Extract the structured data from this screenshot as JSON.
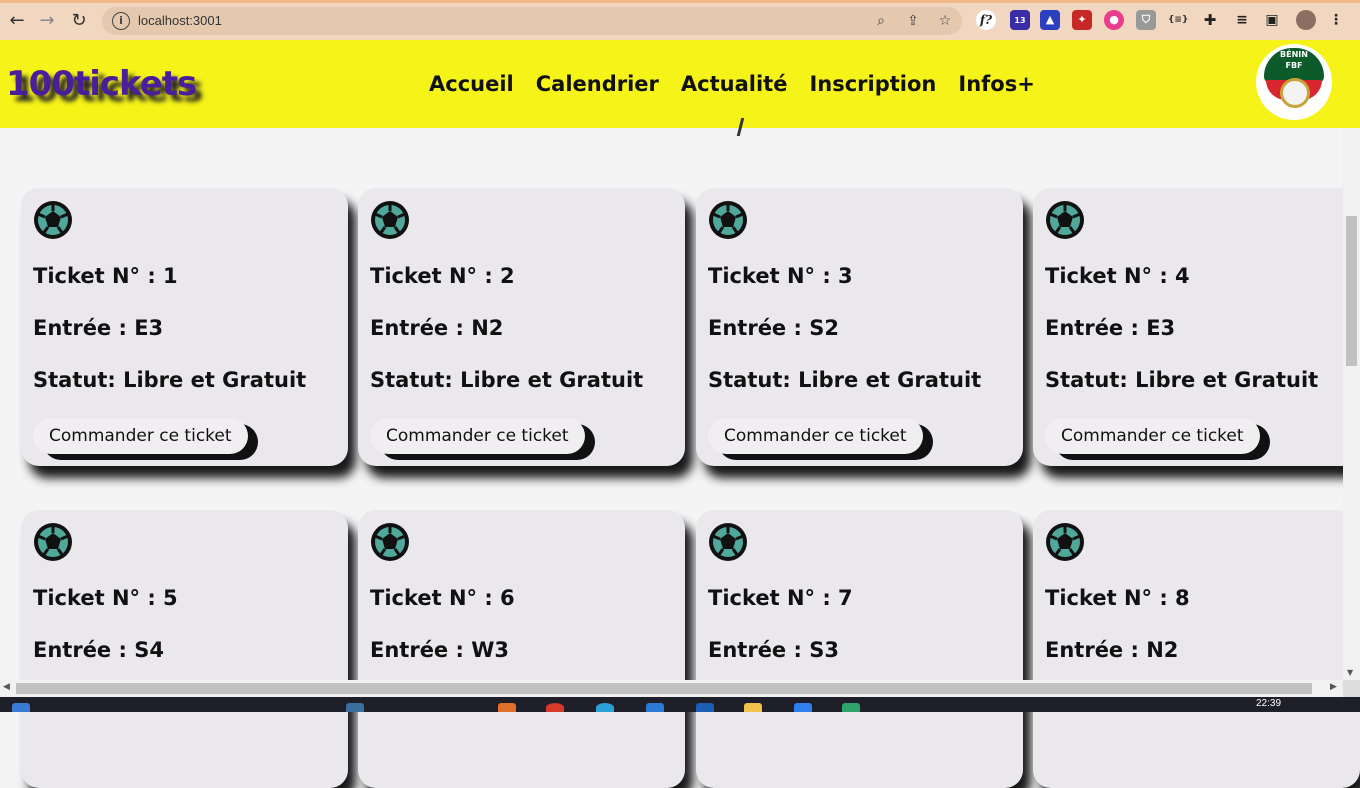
{
  "browser": {
    "url": "localhost:3001",
    "icons": [
      "back-icon",
      "forward-icon",
      "reload-icon",
      "info-icon",
      "zoom-icon",
      "share-icon",
      "star-icon",
      "extensions-icon",
      "media-icon",
      "sidepanel-icon",
      "profile-avatar",
      "menu-icon"
    ],
    "extension_badge": "13",
    "ext_f_label": "f?",
    "ext_code_label": "{≡}"
  },
  "site": {
    "logo": "100tickets",
    "menu": [
      "Accueil",
      "Calendrier",
      "Actualité",
      "Inscription",
      "Infos+"
    ],
    "badge_line1": "BÉNIN",
    "badge_line2": "FBF",
    "logo_color": "#4a1d9a",
    "header_color": "#f5f317"
  },
  "cards": [
    {
      "ticket": "Ticket N° : 1",
      "entree": "Entrée : E3",
      "statut": "Statut: Libre et Gratuit",
      "button": "Commander ce ticket"
    },
    {
      "ticket": "Ticket N° : 2",
      "entree": "Entrée : N2",
      "statut": "Statut: Libre et Gratuit",
      "button": "Commander ce ticket"
    },
    {
      "ticket": "Ticket N° : 3",
      "entree": "Entrée : S2",
      "statut": "Statut: Libre et Gratuit",
      "button": "Commander ce ticket"
    },
    {
      "ticket": "Ticket N° : 4",
      "entree": "Entrée : E3",
      "statut": "Statut: Libre et Gratuit",
      "button": "Commander ce ticket"
    },
    {
      "ticket": "Ticket N° : 5",
      "entree": "Entrée : S4"
    },
    {
      "ticket": "Ticket N° : 6",
      "entree": "Entrée : W3"
    },
    {
      "ticket": "Ticket N° : 7",
      "entree": "Entrée : S3"
    },
    {
      "ticket": "Ticket N° : 8",
      "entree": "Entrée : N2"
    }
  ],
  "taskbar": {
    "time": "22:39"
  }
}
